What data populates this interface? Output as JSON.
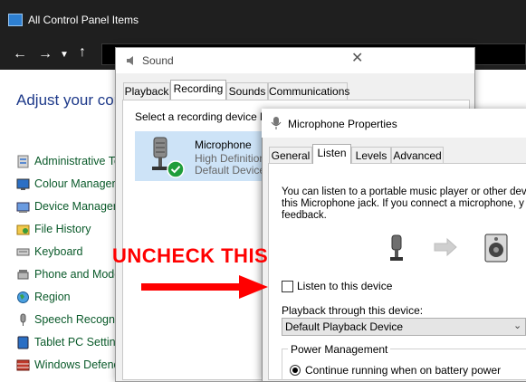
{
  "control_panel": {
    "title": "All Control Panel Items",
    "heading": "Adjust your comp",
    "items": [
      {
        "label": "Administrative Tools",
        "icon": "admin-tools-icon"
      },
      {
        "label": "Colour Management",
        "icon": "colour-management-icon"
      },
      {
        "label": "Device Manager",
        "icon": "device-manager-icon"
      },
      {
        "label": "File History",
        "icon": "file-history-icon"
      },
      {
        "label": "Keyboard",
        "icon": "keyboard-icon"
      },
      {
        "label": "Phone and Modem",
        "icon": "phone-modem-icon"
      },
      {
        "label": "Region",
        "icon": "region-icon"
      },
      {
        "label": "Speech Recognition",
        "icon": "speech-icon"
      },
      {
        "label": "Tablet PC Settings",
        "icon": "tablet-icon"
      },
      {
        "label": "Windows Defender Firewall",
        "icon": "firewall-icon"
      }
    ]
  },
  "sound_dialog": {
    "title": "Sound",
    "tabs": [
      "Playback",
      "Recording",
      "Sounds",
      "Communications"
    ],
    "active_tab": "Recording",
    "instruction": "Select a recording device be",
    "device": {
      "name": "Microphone",
      "line1": "High Definition",
      "line2": "Default Device"
    }
  },
  "mic_properties": {
    "title": "Microphone Properties",
    "tabs": [
      "General",
      "Listen",
      "Levels",
      "Advanced"
    ],
    "active_tab": "Listen",
    "description_lines": [
      "You can listen to a portable music player or other dev",
      "this Microphone jack. If you connect a microphone, y",
      "feedback."
    ],
    "listen_checkbox": {
      "label": "Listen to this device",
      "checked": false
    },
    "playback_label": "Playback through this device:",
    "playback_value": "Default Playback Device",
    "power_group_label": "Power Management",
    "power_option": "Continue running when on battery power"
  },
  "annotation": {
    "text": "UNCHECK THIS",
    "color": "#ff0000"
  }
}
